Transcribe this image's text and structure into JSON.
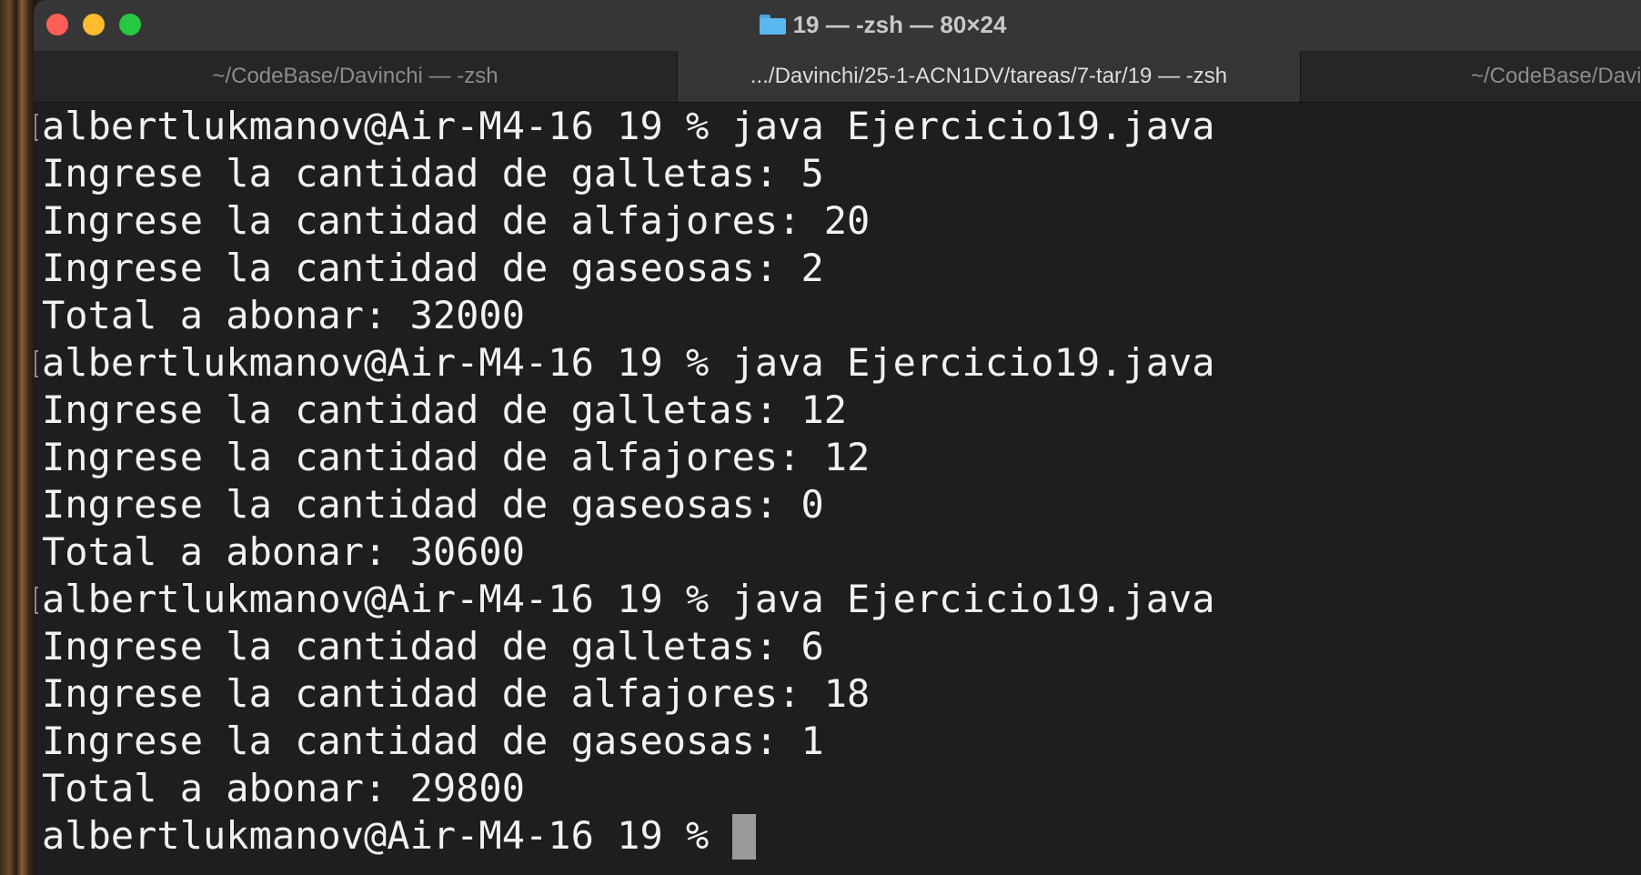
{
  "window": {
    "title": "19 — -zsh — 80×24"
  },
  "tabs": [
    {
      "label": "~/CodeBase/Davinchi — -zsh",
      "active": false
    },
    {
      "label": ".../Davinchi/25-1-ACN1DV/tareas/7-tar/19 — -zsh",
      "active": true
    },
    {
      "label": "~/CodeBase/Davinchi",
      "active": false
    }
  ],
  "terminal": {
    "lines": [
      "albertlukmanov@Air-M4-16 19 % java Ejercicio19.java",
      "Ingrese la cantidad de galletas: 5",
      "Ingrese la cantidad de alfajores: 20",
      "Ingrese la cantidad de gaseosas: 2",
      "Total a abonar: 32000",
      "albertlukmanov@Air-M4-16 19 % java Ejercicio19.java",
      "Ingrese la cantidad de galletas: 12",
      "Ingrese la cantidad de alfajores: 12",
      "Ingrese la cantidad de gaseosas: 0",
      "Total a abonar: 30600",
      "albertlukmanov@Air-M4-16 19 % java Ejercicio19.java",
      "Ingrese la cantidad de galletas: 6",
      "Ingrese la cantidad de alfajores: 18",
      "Ingrese la cantidad de gaseosas: 1",
      "Total a abonar: 29800"
    ],
    "prompt": "albertlukmanov@Air-M4-16 19 % "
  },
  "icons": {
    "title_icon": "folder-icon"
  },
  "colors": {
    "close": "#ff5f57",
    "minimize": "#febc2e",
    "zoom": "#28c840",
    "folder": "#5bb7f0",
    "terminal_bg": "#1e1e1e",
    "terminal_fg": "#f2f2f2"
  }
}
